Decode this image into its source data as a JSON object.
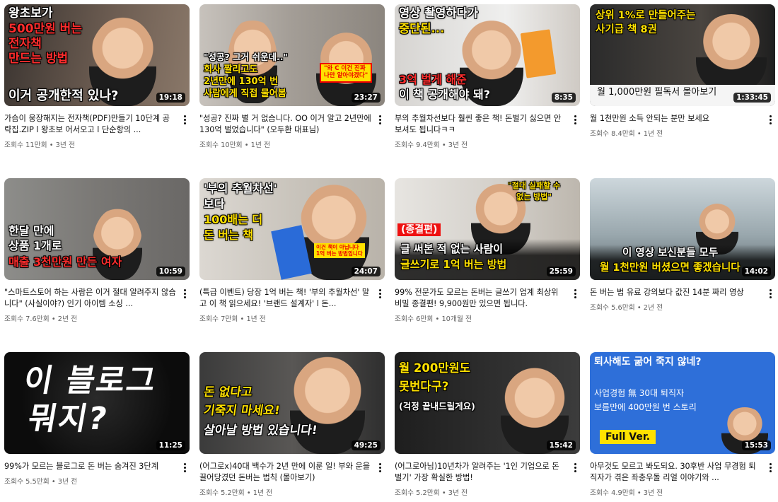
{
  "videos": [
    {
      "title": "가슴이 웅장해지는 전자책(PDF)만들기 10단계 공략집.ZIP l 왕초보 어서오고 l 단순항의 ...",
      "views": "조회수 11만회",
      "age": "3년 전",
      "duration": "19:18",
      "overlay": [
        "왕초보가",
        "500만원 버는",
        "전자책",
        "만드는 방법",
        "이거 공개한적 있나?"
      ]
    },
    {
      "title": "\"성공? 진짜 별 거 없습니다. OO 이거 알고 2년만에 130억 벌었습니다\" (오두환 대표님)",
      "views": "조회수 10만회",
      "age": "1년 전",
      "duration": "23:27",
      "overlay": [
        "\"성공? 그거 쉬운데..\"",
        "회사 짤리고도",
        "2년만에 130억 번",
        "사람에게 직접 물어봄",
        "\"와 C 이건 진짜",
        "나만 알아야겠다\""
      ]
    },
    {
      "title": "부의 추월차선보다 훨씬 좋은 책! 돈벌기 싫으면 안보셔도 됩니다ㅋㅋ",
      "views": "조회수 9.4만회",
      "age": "3년 전",
      "duration": "8:35",
      "overlay": [
        "영상 촬영하다가",
        "중단된...",
        "3억 벌게 해준",
        "이 책 공개해야 돼?"
      ]
    },
    {
      "title": "월 1천만원 소득 안되는 분만 보세요",
      "views": "조회수 8.4만회",
      "age": "1년 전",
      "duration": "1:33:45",
      "overlay": [
        "상위 1%로 만들어주는",
        "사기급 책 8권",
        "월 1,000만원 필독서 몰아보기"
      ]
    },
    {
      "title": "\"스마트스토어 하는 사람은 이거 절대 알려주지 않습니다\" (사실이야?) 인기 아이템 소싱 ...",
      "views": "조회수 7.6만회",
      "age": "2년 전",
      "duration": "10:59",
      "overlay": [
        "한달 만에",
        "상품 1개로",
        "매출 3천만원 만든 여자"
      ]
    },
    {
      "title": "(특급 이벤트) 당장 1억 버는 책! '부의 추월차선' 말고 이 책 읽으세요! '브랜드 설계자' l 돈...",
      "views": "조회수 7만회",
      "age": "1년 전",
      "duration": "24:07",
      "overlay": [
        "'부의 추월차선'",
        "보다",
        "100배는 더",
        "돈 버는 책",
        "이건 책이 아닙니다",
        "1억 버는 방법입니다"
      ]
    },
    {
      "title": "99% 전문가도 모르는 돈버는 글쓰기 업계 최상위 비밀 종결편! 9,900원만 있으면 됩니다.",
      "views": "조회수 6만회",
      "age": "10개월 전",
      "duration": "25:59",
      "overlay": [
        "\"절대 실패할 수",
        "없는 방법\"",
        "(종결편)",
        "글 써본 적 없는 사람이",
        "글쓰기로 1억 버는 방법"
      ]
    },
    {
      "title": "돈 버는 법 유료 강의보다 값진 14분 짜리 영상",
      "views": "조회수 5.6만회",
      "age": "2년 전",
      "duration": "14:02",
      "overlay": [
        "이 영상 보신분들 모두",
        "월 1천만원 버셨으면 좋겠습니다"
      ]
    },
    {
      "title": "99%가 모르는 블로그로 돈 버는 숨겨진 3단계",
      "views": "조회수 5.5만회",
      "age": "3년 전",
      "duration": "11:25",
      "overlay": [
        "이 블로그",
        "뭐지?"
      ]
    },
    {
      "title": "(어그로x)40대 백수가 2년 만에 이룬 일! 부와 운을 끌어당겼던 돈버는 법칙 (몰아보기)",
      "views": "조회수 5.2만회",
      "age": "1년 전",
      "duration": "49:25",
      "overlay": [
        "돈 없다고",
        "기죽지 마세요!",
        "살아날 방법 있습니다!"
      ]
    },
    {
      "title": "(어그로아님)10년차가 알려주는 '1인 기업으로 돈 벌기' 가장 확실한 방법!",
      "views": "조회수 5.2만회",
      "age": "3년 전",
      "duration": "15:42",
      "overlay": [
        "월 200만원도",
        "못번다구?",
        "(걱정 끝내드릴게요)"
      ]
    },
    {
      "title": "아무것도 모르고 봐도되요. 30후반 사업 무경험 퇴직자가 겪은 좌충우돌 리얼 이야기와 ...",
      "views": "조회수 4.9만회",
      "age": "3년 전",
      "duration": "15:53",
      "overlay": [
        "퇴사해도 굶어 죽지 않네?",
        "사업경험 無 30대 퇴직자",
        "보름만에 400만원 번 스토리",
        "Full Ver."
      ]
    }
  ],
  "colors": {
    "red": "#ff1e1e",
    "yellow": "#ffe100",
    "blue": "#2e6fd9"
  }
}
